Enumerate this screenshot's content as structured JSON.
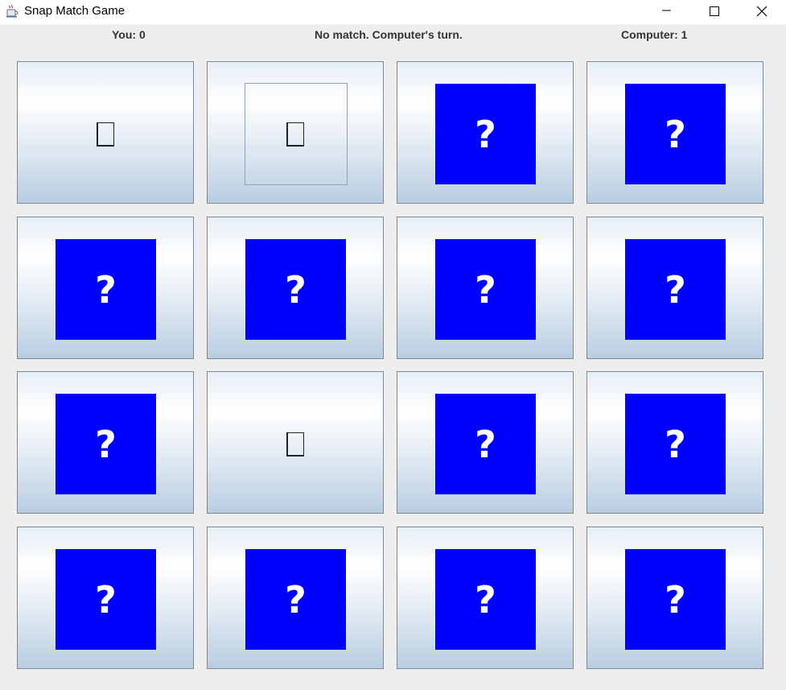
{
  "window": {
    "title": "Snap Match Game",
    "icon": "java-coffee-cup-icon",
    "controls": [
      "minimize-icon",
      "maximize-icon",
      "close-icon"
    ]
  },
  "status": {
    "player_score": "You: 0",
    "message": "No match. Computer's turn.",
    "computer_score": "Computer: 1"
  },
  "board": {
    "rows": 4,
    "cols": 4,
    "hidden_label": "?",
    "hidden_color": "#0000ff",
    "cards": [
      {
        "state": "revealed",
        "glyph": "missing-glyph"
      },
      {
        "state": "revealed",
        "glyph": "missing-glyph",
        "focused": true
      },
      {
        "state": "hidden"
      },
      {
        "state": "hidden"
      },
      {
        "state": "hidden"
      },
      {
        "state": "hidden"
      },
      {
        "state": "hidden"
      },
      {
        "state": "hidden"
      },
      {
        "state": "hidden"
      },
      {
        "state": "revealed",
        "glyph": "missing-glyph"
      },
      {
        "state": "hidden"
      },
      {
        "state": "hidden"
      },
      {
        "state": "hidden"
      },
      {
        "state": "hidden"
      },
      {
        "state": "hidden"
      },
      {
        "state": "hidden"
      }
    ]
  }
}
